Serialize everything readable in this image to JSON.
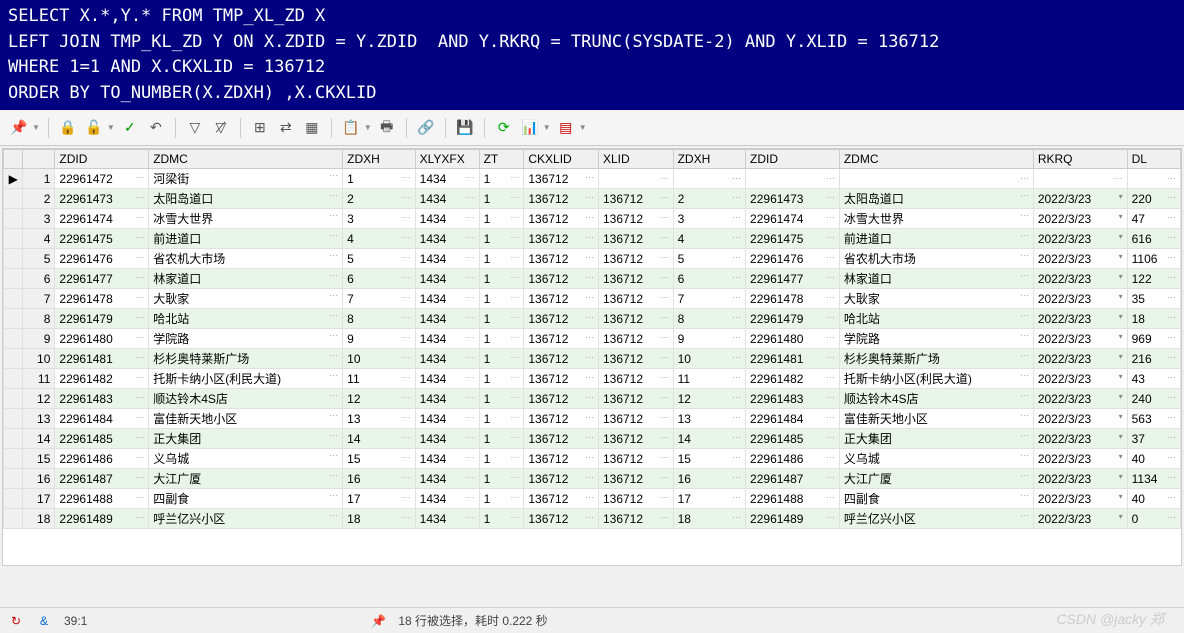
{
  "sql": {
    "line1": "SELECT X.*,Y.* FROM TMP_XL_ZD X",
    "line2": "LEFT JOIN TMP_KL_ZD Y ON X.ZDID = Y.ZDID  AND Y.RKRQ = TRUNC(SYSDATE-2) AND Y.XLID = 136712",
    "line3": "WHERE 1=1 AND X.CKXLID = 136712",
    "line4": "ORDER BY TO_NUMBER(X.ZDXH) ,X.CKXLID"
  },
  "columns": [
    "ZDID",
    "ZDMC",
    "ZDXH",
    "XLYXFX",
    "ZT",
    "CKXLID",
    "XLID",
    "ZDXH",
    "ZDID",
    "ZDMC",
    "RKRQ",
    "DL"
  ],
  "rows": [
    {
      "n": 1,
      "zdid": "22961472",
      "zdmc": "河梁街",
      "zdxh": "1",
      "xlyxfx": "1434",
      "zt": "1",
      "ckxlid": "136712",
      "xlid": "",
      "zdxh2": "",
      "zdid2": "",
      "zdmc2": "",
      "rkrq": "",
      "dl": ""
    },
    {
      "n": 2,
      "zdid": "22961473",
      "zdmc": "太阳岛道口",
      "zdxh": "2",
      "xlyxfx": "1434",
      "zt": "1",
      "ckxlid": "136712",
      "xlid": "136712",
      "zdxh2": "2",
      "zdid2": "22961473",
      "zdmc2": "太阳岛道口",
      "rkrq": "2022/3/23",
      "dl": "220"
    },
    {
      "n": 3,
      "zdid": "22961474",
      "zdmc": "冰雪大世界",
      "zdxh": "3",
      "xlyxfx": "1434",
      "zt": "1",
      "ckxlid": "136712",
      "xlid": "136712",
      "zdxh2": "3",
      "zdid2": "22961474",
      "zdmc2": "冰雪大世界",
      "rkrq": "2022/3/23",
      "dl": "47"
    },
    {
      "n": 4,
      "zdid": "22961475",
      "zdmc": "前进道口",
      "zdxh": "4",
      "xlyxfx": "1434",
      "zt": "1",
      "ckxlid": "136712",
      "xlid": "136712",
      "zdxh2": "4",
      "zdid2": "22961475",
      "zdmc2": "前进道口",
      "rkrq": "2022/3/23",
      "dl": "616"
    },
    {
      "n": 5,
      "zdid": "22961476",
      "zdmc": "省农机大市场",
      "zdxh": "5",
      "xlyxfx": "1434",
      "zt": "1",
      "ckxlid": "136712",
      "xlid": "136712",
      "zdxh2": "5",
      "zdid2": "22961476",
      "zdmc2": "省农机大市场",
      "rkrq": "2022/3/23",
      "dl": "1106"
    },
    {
      "n": 6,
      "zdid": "22961477",
      "zdmc": "林家道口",
      "zdxh": "6",
      "xlyxfx": "1434",
      "zt": "1",
      "ckxlid": "136712",
      "xlid": "136712",
      "zdxh2": "6",
      "zdid2": "22961477",
      "zdmc2": "林家道口",
      "rkrq": "2022/3/23",
      "dl": "122"
    },
    {
      "n": 7,
      "zdid": "22961478",
      "zdmc": "大耿家",
      "zdxh": "7",
      "xlyxfx": "1434",
      "zt": "1",
      "ckxlid": "136712",
      "xlid": "136712",
      "zdxh2": "7",
      "zdid2": "22961478",
      "zdmc2": "大耿家",
      "rkrq": "2022/3/23",
      "dl": "35"
    },
    {
      "n": 8,
      "zdid": "22961479",
      "zdmc": "哈北站",
      "zdxh": "8",
      "xlyxfx": "1434",
      "zt": "1",
      "ckxlid": "136712",
      "xlid": "136712",
      "zdxh2": "8",
      "zdid2": "22961479",
      "zdmc2": "哈北站",
      "rkrq": "2022/3/23",
      "dl": "18"
    },
    {
      "n": 9,
      "zdid": "22961480",
      "zdmc": "学院路",
      "zdxh": "9",
      "xlyxfx": "1434",
      "zt": "1",
      "ckxlid": "136712",
      "xlid": "136712",
      "zdxh2": "9",
      "zdid2": "22961480",
      "zdmc2": "学院路",
      "rkrq": "2022/3/23",
      "dl": "969"
    },
    {
      "n": 10,
      "zdid": "22961481",
      "zdmc": "杉杉奥特莱斯广场",
      "zdxh": "10",
      "xlyxfx": "1434",
      "zt": "1",
      "ckxlid": "136712",
      "xlid": "136712",
      "zdxh2": "10",
      "zdid2": "22961481",
      "zdmc2": "杉杉奥特莱斯广场",
      "rkrq": "2022/3/23",
      "dl": "216"
    },
    {
      "n": 11,
      "zdid": "22961482",
      "zdmc": "托斯卡纳小区(利民大道)",
      "zdxh": "11",
      "xlyxfx": "1434",
      "zt": "1",
      "ckxlid": "136712",
      "xlid": "136712",
      "zdxh2": "11",
      "zdid2": "22961482",
      "zdmc2": "托斯卡纳小区(利民大道)",
      "rkrq": "2022/3/23",
      "dl": "43"
    },
    {
      "n": 12,
      "zdid": "22961483",
      "zdmc": "顺达铃木4S店",
      "zdxh": "12",
      "xlyxfx": "1434",
      "zt": "1",
      "ckxlid": "136712",
      "xlid": "136712",
      "zdxh2": "12",
      "zdid2": "22961483",
      "zdmc2": "顺达铃木4S店",
      "rkrq": "2022/3/23",
      "dl": "240"
    },
    {
      "n": 13,
      "zdid": "22961484",
      "zdmc": "富佳新天地小区",
      "zdxh": "13",
      "xlyxfx": "1434",
      "zt": "1",
      "ckxlid": "136712",
      "xlid": "136712",
      "zdxh2": "13",
      "zdid2": "22961484",
      "zdmc2": "富佳新天地小区",
      "rkrq": "2022/3/23",
      "dl": "563"
    },
    {
      "n": 14,
      "zdid": "22961485",
      "zdmc": "正大集团",
      "zdxh": "14",
      "xlyxfx": "1434",
      "zt": "1",
      "ckxlid": "136712",
      "xlid": "136712",
      "zdxh2": "14",
      "zdid2": "22961485",
      "zdmc2": "正大集团",
      "rkrq": "2022/3/23",
      "dl": "37"
    },
    {
      "n": 15,
      "zdid": "22961486",
      "zdmc": "义乌城",
      "zdxh": "15",
      "xlyxfx": "1434",
      "zt": "1",
      "ckxlid": "136712",
      "xlid": "136712",
      "zdxh2": "15",
      "zdid2": "22961486",
      "zdmc2": "义乌城",
      "rkrq": "2022/3/23",
      "dl": "40"
    },
    {
      "n": 16,
      "zdid": "22961487",
      "zdmc": "大江广厦",
      "zdxh": "16",
      "xlyxfx": "1434",
      "zt": "1",
      "ckxlid": "136712",
      "xlid": "136712",
      "zdxh2": "16",
      "zdid2": "22961487",
      "zdmc2": "大江广厦",
      "rkrq": "2022/3/23",
      "dl": "1134"
    },
    {
      "n": 17,
      "zdid": "22961488",
      "zdmc": "四副食",
      "zdxh": "17",
      "xlyxfx": "1434",
      "zt": "1",
      "ckxlid": "136712",
      "xlid": "136712",
      "zdxh2": "17",
      "zdid2": "22961488",
      "zdmc2": "四副食",
      "rkrq": "2022/3/23",
      "dl": "40"
    },
    {
      "n": 18,
      "zdid": "22961489",
      "zdmc": "呼兰亿兴小区",
      "zdxh": "18",
      "xlyxfx": "1434",
      "zt": "1",
      "ckxlid": "136712",
      "xlid": "136712",
      "zdxh2": "18",
      "zdid2": "22961489",
      "zdmc2": "呼兰亿兴小区",
      "rkrq": "2022/3/23",
      "dl": "0"
    }
  ],
  "status": {
    "cursor": "39:1",
    "msg": "18 行被选择，耗时 0.222 秒"
  },
  "watermark": "CSDN @jacky 郑"
}
